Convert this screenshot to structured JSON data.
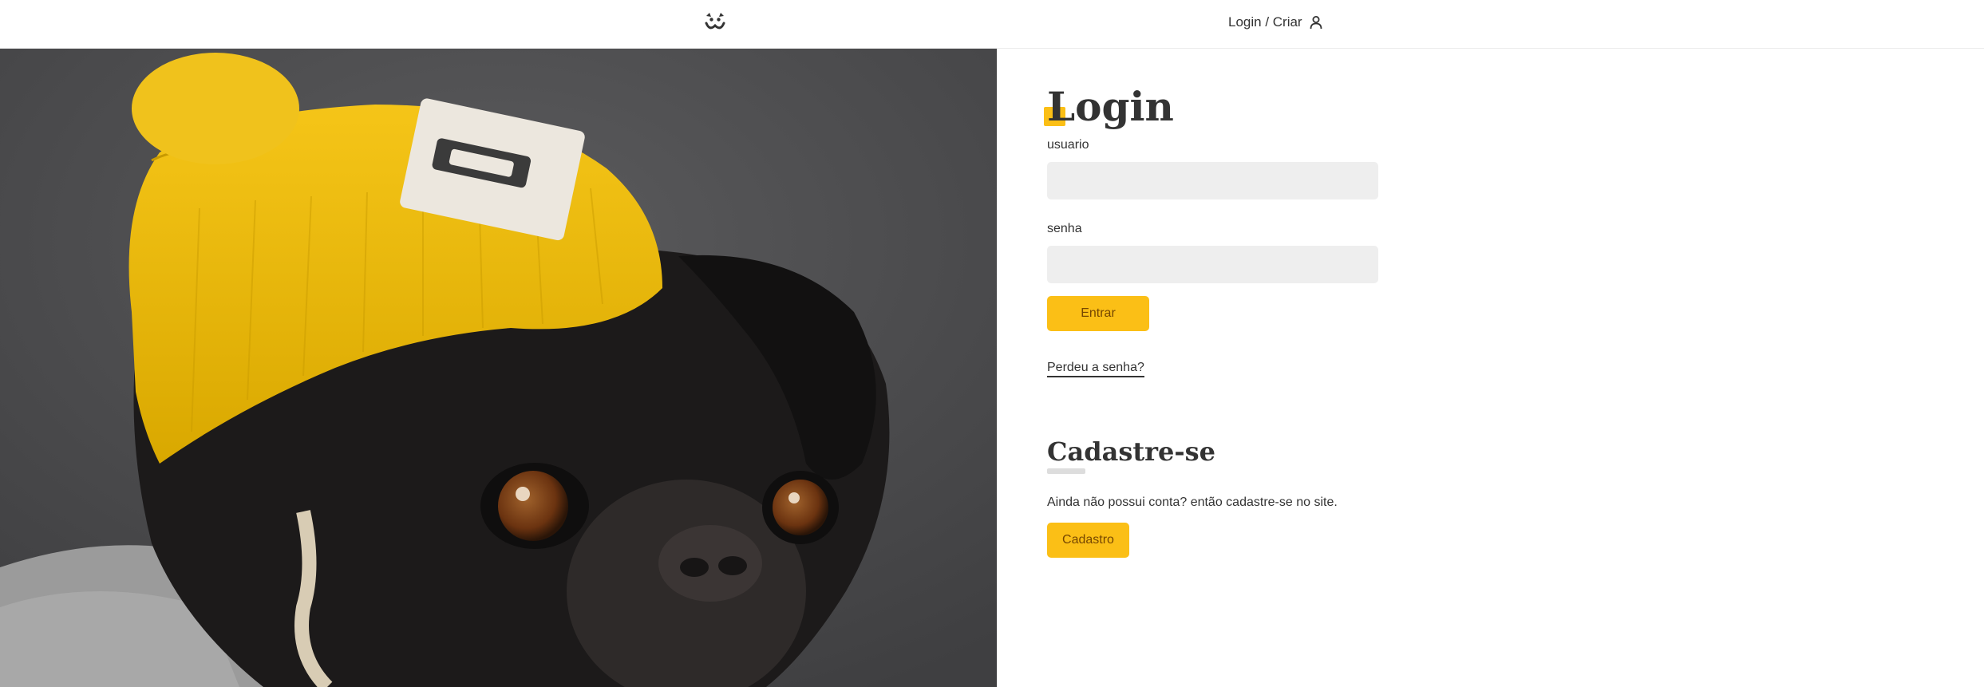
{
  "header": {
    "logo_icon": "dog-face-icon",
    "login_label": "Login / Criar",
    "user_icon": "user-icon"
  },
  "hero": {
    "image": "pug-with-yellow-beanie-photo"
  },
  "login": {
    "title": "Login",
    "username_label": "usuario",
    "username_value": "",
    "password_label": "senha",
    "password_value": "",
    "submit_label": "Entrar",
    "lost_password": "Perdeu a senha?"
  },
  "signup": {
    "title": "Cadastre-se",
    "text": "Ainda não possui conta? então cadastre-se no site.",
    "button_label": "Cadastro"
  },
  "colors": {
    "accent": "#fbbf16",
    "button_text": "#764701",
    "input_bg": "#eeeeee",
    "text": "#333333"
  }
}
